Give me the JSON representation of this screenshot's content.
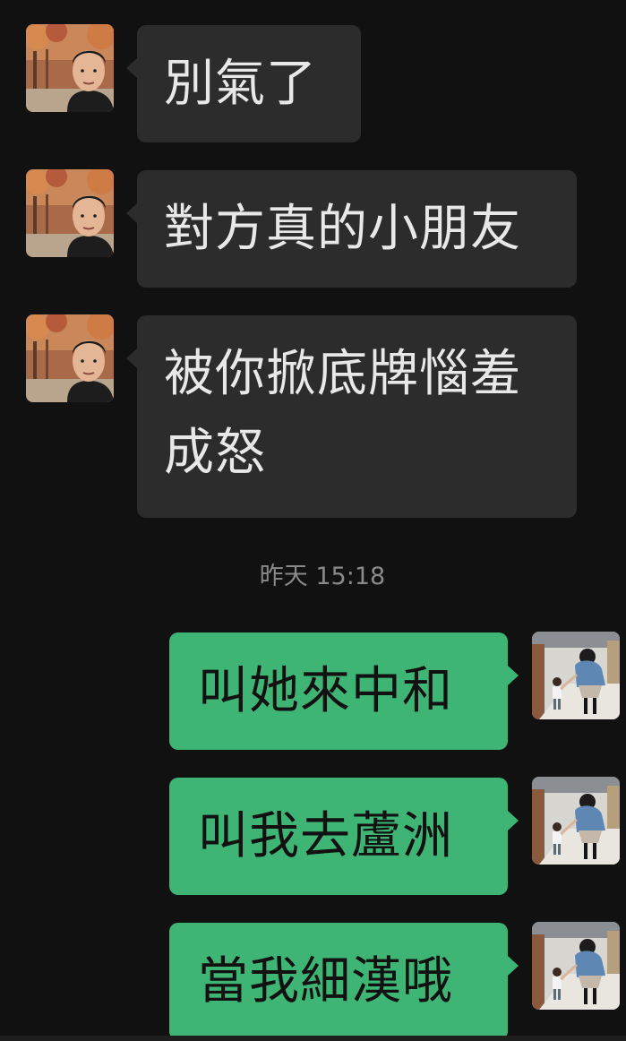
{
  "conversation": {
    "incoming": [
      {
        "text": "別氣了",
        "avatar": "man-autumn-photo-avatar"
      },
      {
        "text": "對方真的小朋友",
        "avatar": "man-autumn-photo-avatar"
      },
      {
        "text": "被你掀底牌惱羞成怒",
        "avatar": "man-autumn-photo-avatar"
      }
    ],
    "timestamp": "昨天 15:18",
    "outgoing": [
      {
        "text": "叫她來中和",
        "avatar": "mother-child-photo-avatar"
      },
      {
        "text": "叫我去蘆洲",
        "avatar": "mother-child-photo-avatar"
      },
      {
        "text": "當我細漢哦",
        "avatar": "mother-child-photo-avatar"
      }
    ]
  },
  "colors": {
    "background": "#111111",
    "incoming_bubble": "#2c2c2c",
    "outgoing_bubble": "#3eb575",
    "timestamp_text": "#8a8a8a"
  }
}
